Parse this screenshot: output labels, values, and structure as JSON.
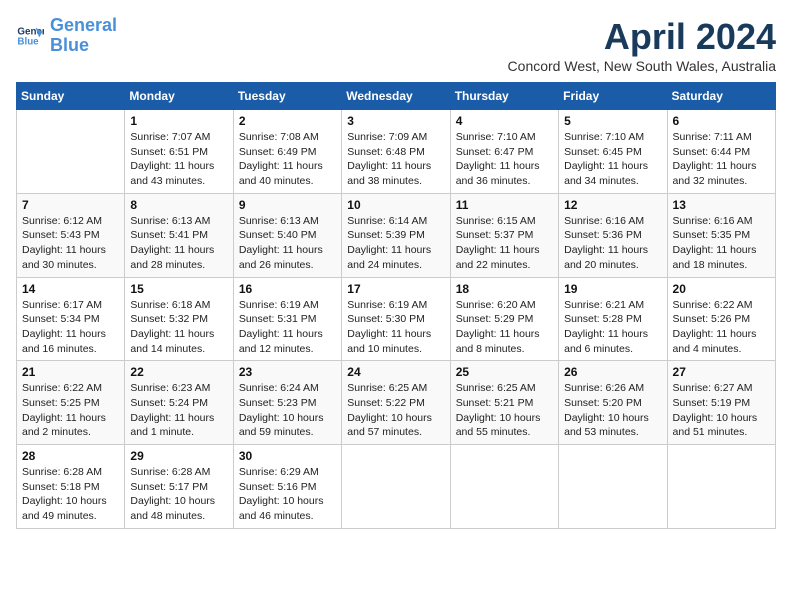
{
  "logo": {
    "line1": "General",
    "line2": "Blue"
  },
  "title": "April 2024",
  "subtitle": "Concord West, New South Wales, Australia",
  "weekdays": [
    "Sunday",
    "Monday",
    "Tuesday",
    "Wednesday",
    "Thursday",
    "Friday",
    "Saturday"
  ],
  "weeks": [
    [
      {
        "day": "",
        "content": ""
      },
      {
        "day": "1",
        "content": "Sunrise: 7:07 AM\nSunset: 6:51 PM\nDaylight: 11 hours\nand 43 minutes."
      },
      {
        "day": "2",
        "content": "Sunrise: 7:08 AM\nSunset: 6:49 PM\nDaylight: 11 hours\nand 40 minutes."
      },
      {
        "day": "3",
        "content": "Sunrise: 7:09 AM\nSunset: 6:48 PM\nDaylight: 11 hours\nand 38 minutes."
      },
      {
        "day": "4",
        "content": "Sunrise: 7:10 AM\nSunset: 6:47 PM\nDaylight: 11 hours\nand 36 minutes."
      },
      {
        "day": "5",
        "content": "Sunrise: 7:10 AM\nSunset: 6:45 PM\nDaylight: 11 hours\nand 34 minutes."
      },
      {
        "day": "6",
        "content": "Sunrise: 7:11 AM\nSunset: 6:44 PM\nDaylight: 11 hours\nand 32 minutes."
      }
    ],
    [
      {
        "day": "7",
        "content": "Sunrise: 6:12 AM\nSunset: 5:43 PM\nDaylight: 11 hours\nand 30 minutes."
      },
      {
        "day": "8",
        "content": "Sunrise: 6:13 AM\nSunset: 5:41 PM\nDaylight: 11 hours\nand 28 minutes."
      },
      {
        "day": "9",
        "content": "Sunrise: 6:13 AM\nSunset: 5:40 PM\nDaylight: 11 hours\nand 26 minutes."
      },
      {
        "day": "10",
        "content": "Sunrise: 6:14 AM\nSunset: 5:39 PM\nDaylight: 11 hours\nand 24 minutes."
      },
      {
        "day": "11",
        "content": "Sunrise: 6:15 AM\nSunset: 5:37 PM\nDaylight: 11 hours\nand 22 minutes."
      },
      {
        "day": "12",
        "content": "Sunrise: 6:16 AM\nSunset: 5:36 PM\nDaylight: 11 hours\nand 20 minutes."
      },
      {
        "day": "13",
        "content": "Sunrise: 6:16 AM\nSunset: 5:35 PM\nDaylight: 11 hours\nand 18 minutes."
      }
    ],
    [
      {
        "day": "14",
        "content": "Sunrise: 6:17 AM\nSunset: 5:34 PM\nDaylight: 11 hours\nand 16 minutes."
      },
      {
        "day": "15",
        "content": "Sunrise: 6:18 AM\nSunset: 5:32 PM\nDaylight: 11 hours\nand 14 minutes."
      },
      {
        "day": "16",
        "content": "Sunrise: 6:19 AM\nSunset: 5:31 PM\nDaylight: 11 hours\nand 12 minutes."
      },
      {
        "day": "17",
        "content": "Sunrise: 6:19 AM\nSunset: 5:30 PM\nDaylight: 11 hours\nand 10 minutes."
      },
      {
        "day": "18",
        "content": "Sunrise: 6:20 AM\nSunset: 5:29 PM\nDaylight: 11 hours\nand 8 minutes."
      },
      {
        "day": "19",
        "content": "Sunrise: 6:21 AM\nSunset: 5:28 PM\nDaylight: 11 hours\nand 6 minutes."
      },
      {
        "day": "20",
        "content": "Sunrise: 6:22 AM\nSunset: 5:26 PM\nDaylight: 11 hours\nand 4 minutes."
      }
    ],
    [
      {
        "day": "21",
        "content": "Sunrise: 6:22 AM\nSunset: 5:25 PM\nDaylight: 11 hours\nand 2 minutes."
      },
      {
        "day": "22",
        "content": "Sunrise: 6:23 AM\nSunset: 5:24 PM\nDaylight: 11 hours\nand 1 minute."
      },
      {
        "day": "23",
        "content": "Sunrise: 6:24 AM\nSunset: 5:23 PM\nDaylight: 10 hours\nand 59 minutes."
      },
      {
        "day": "24",
        "content": "Sunrise: 6:25 AM\nSunset: 5:22 PM\nDaylight: 10 hours\nand 57 minutes."
      },
      {
        "day": "25",
        "content": "Sunrise: 6:25 AM\nSunset: 5:21 PM\nDaylight: 10 hours\nand 55 minutes."
      },
      {
        "day": "26",
        "content": "Sunrise: 6:26 AM\nSunset: 5:20 PM\nDaylight: 10 hours\nand 53 minutes."
      },
      {
        "day": "27",
        "content": "Sunrise: 6:27 AM\nSunset: 5:19 PM\nDaylight: 10 hours\nand 51 minutes."
      }
    ],
    [
      {
        "day": "28",
        "content": "Sunrise: 6:28 AM\nSunset: 5:18 PM\nDaylight: 10 hours\nand 49 minutes."
      },
      {
        "day": "29",
        "content": "Sunrise: 6:28 AM\nSunset: 5:17 PM\nDaylight: 10 hours\nand 48 minutes."
      },
      {
        "day": "30",
        "content": "Sunrise: 6:29 AM\nSunset: 5:16 PM\nDaylight: 10 hours\nand 46 minutes."
      },
      {
        "day": "",
        "content": ""
      },
      {
        "day": "",
        "content": ""
      },
      {
        "day": "",
        "content": ""
      },
      {
        "day": "",
        "content": ""
      }
    ]
  ]
}
